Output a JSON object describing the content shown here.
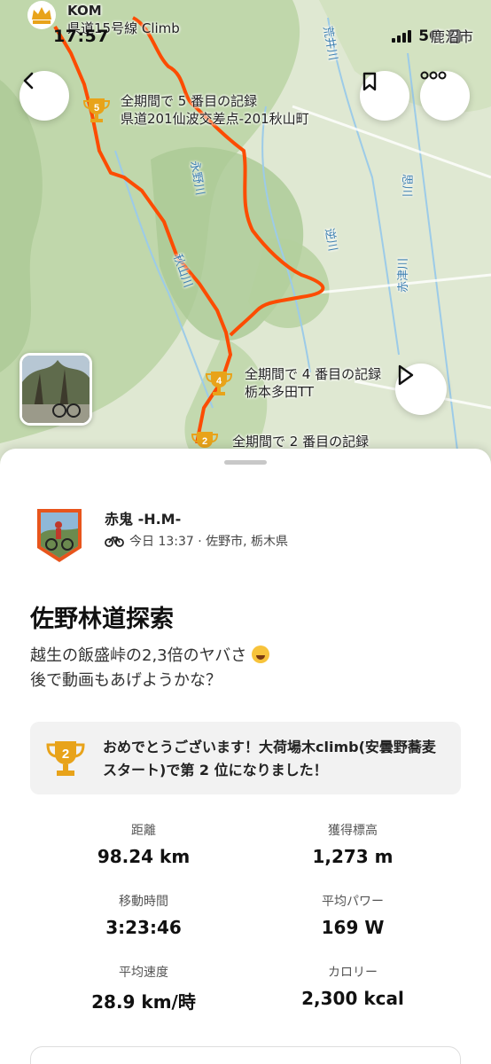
{
  "status_bar": {
    "time": "17:57",
    "network": "5G",
    "battery_glyph": "3"
  },
  "map": {
    "kom_label": "KOM",
    "kom_segment": "県道15号線 Climb",
    "top_prefix_text": "鹿沼市",
    "pin5": {
      "rank": "5",
      "line1": "全期間で 5 番目の記録",
      "line2": "県道201仙波交差点-201秋山町"
    },
    "pin4": {
      "rank": "4",
      "line1": "全期間で 4 番目の記録",
      "line2": "栃本多田TT"
    },
    "pin2": {
      "rank": "2",
      "line1": "全期間で 2 番目の記録"
    },
    "place_labels": {
      "nagano_river": "永野川",
      "akiyama_river": "秋山川",
      "sakai_river": "逆川",
      "omoi_river": "思川",
      "akatsu_river": "赤津川",
      "arai_river": "荒井川"
    },
    "icons": [
      "back-icon",
      "bookmark-icon",
      "more-icon",
      "play-icon",
      "trophy-icon",
      "crown-icon"
    ]
  },
  "activity": {
    "athlete_name": "赤鬼 -H.M-",
    "meta": "今日 13:37 · 佐野市, 栃木県",
    "title": "佐野林道探索",
    "desc_line1": "越生の飯盛峠の2,3倍のヤバさ",
    "desc_line2": "後で動画もあげようかな？",
    "achievement_rank": "2",
    "achievement_text": "おめでとうございます！大荷場木climb(安曇野蕎麦スタート)で第 2 位になりました！"
  },
  "stats": [
    {
      "label": "距離",
      "value": "98.24 km"
    },
    {
      "label": "獲得標高",
      "value": "1,273 m"
    },
    {
      "label": "移動時間",
      "value": "3:23:46"
    },
    {
      "label": "平均パワー",
      "value": "169 W"
    },
    {
      "label": "平均速度",
      "value": "28.9 km/時"
    },
    {
      "label": "カロリー",
      "value": "2,300 kcal"
    }
  ],
  "colors": {
    "route": "#fc4c02",
    "trophy_gold": "#e8a31a",
    "map_land": "#dfe9d3",
    "map_forest": "#b9d4a3"
  }
}
